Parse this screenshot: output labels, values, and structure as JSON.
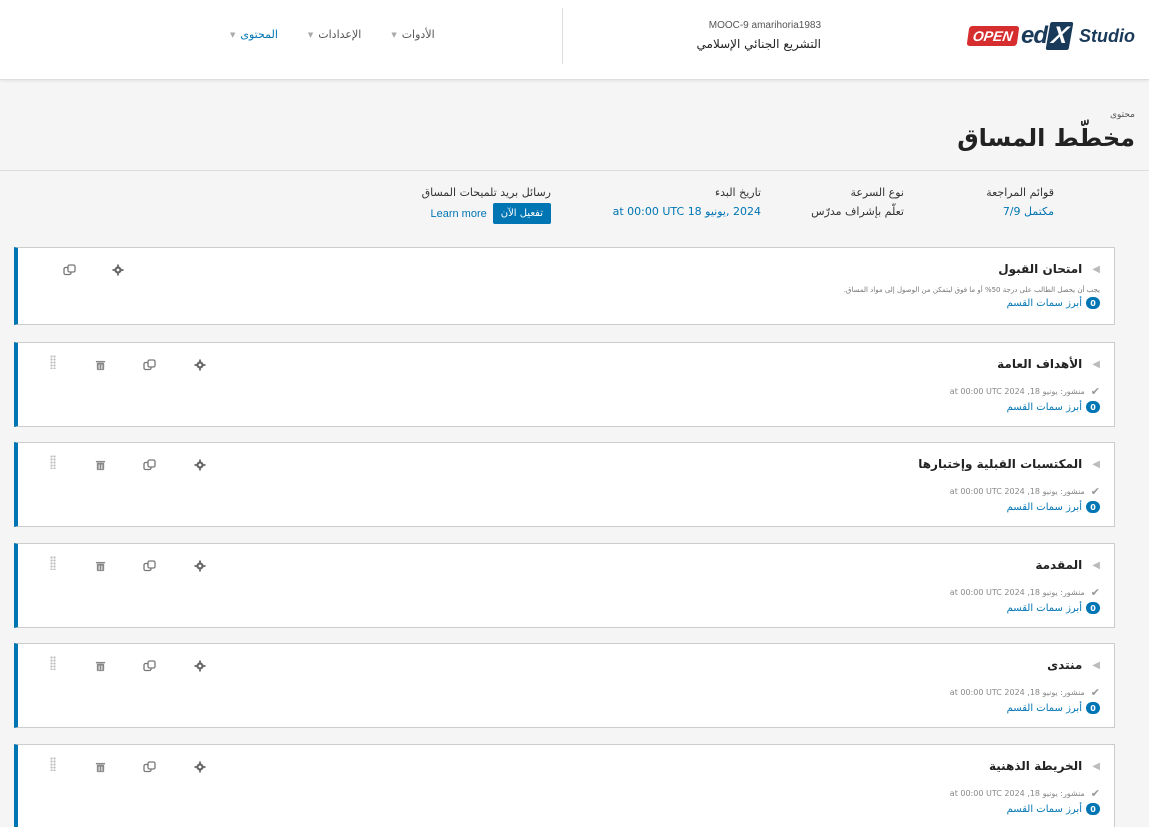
{
  "header": {
    "logo": {
      "open": "OPEN",
      "ed": "ed",
      "x": "X",
      "studio": "Studio"
    },
    "course_org": "MOOC-9 amarihoria1983",
    "course_name": "التشريع الجنائي الإسلامي",
    "nav": [
      {
        "label": "المحتوى",
        "active": true
      },
      {
        "label": "الإعدادات",
        "active": false
      },
      {
        "label": "الأدوات",
        "active": false
      }
    ]
  },
  "page": {
    "breadcrumb": "محتوى",
    "title": "مخطّط المساق"
  },
  "status": {
    "checklists_label": "قوائم المراجعة",
    "checklists_value": "مكتمل 7/9",
    "pacing_label": "نوع السرعة",
    "pacing_value": "تعلّم بإشراف مدرّس",
    "start_label": "تاريخ البدء",
    "start_value": "2024 ,يونيو 18 at 00:00 UTC",
    "email_label": "رسائل بريد تلميحات المساق",
    "activate_label": "تفعيل الآن",
    "learn_more": "Learn more"
  },
  "sections": [
    {
      "title": "امتحان القبول",
      "note": "يجب أن يحصل الطالب على درجة 50% أو ما فوق ليتمكن من الوصول إلى مواد المساق.",
      "status": "",
      "highlight_count": "0",
      "highlight_label": "أبرز سمات القسم",
      "deletable": false
    },
    {
      "title": "الأهداف العامة",
      "note": "",
      "status": "منشور: يونيو 18, 2024 at 00:00 UTC",
      "highlight_count": "0",
      "highlight_label": "أبرز سمات القسم",
      "deletable": true
    },
    {
      "title": "المكتسبات القبلية وإختبارها",
      "note": "",
      "status": "منشور: يونيو 18, 2024 at 00:00 UTC",
      "highlight_count": "0",
      "highlight_label": "أبرز سمات القسم",
      "deletable": true
    },
    {
      "title": "المقدمة",
      "note": "",
      "status": "منشور: يونيو 18, 2024 at 00:00 UTC",
      "highlight_count": "0",
      "highlight_label": "أبرز سمات القسم",
      "deletable": true
    },
    {
      "title": "منتدى",
      "note": "",
      "status": "منشور: يونيو 18, 2024 at 00:00 UTC",
      "highlight_count": "0",
      "highlight_label": "أبرز سمات القسم",
      "deletable": true
    },
    {
      "title": "الخريطة الذهنية",
      "note": "",
      "status": "منشور: يونيو 18, 2024 at 00:00 UTC",
      "highlight_count": "0",
      "highlight_label": "أبرز سمات القسم",
      "deletable": true
    }
  ],
  "colors": {
    "accent": "#0075b4",
    "logo_red": "#d62e2e",
    "logo_navy": "#1a3a5a"
  },
  "icons": {
    "gear": "gear-icon",
    "copy": "duplicate-icon",
    "trash": "delete-icon",
    "drag": "drag-handle-icon",
    "expand": "expand-triangle-icon",
    "check": "check-icon"
  }
}
